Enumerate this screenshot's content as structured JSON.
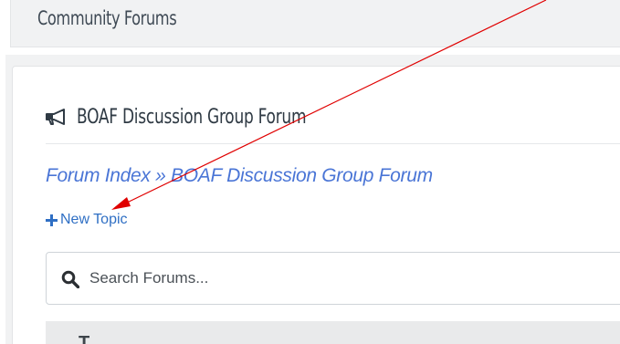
{
  "header": {
    "title": "Community Forums"
  },
  "forum": {
    "title": "BOAF Discussion Group Forum",
    "icon": "megaphone-icon"
  },
  "breadcrumb": {
    "index_label": "Forum Index",
    "separator": " » ",
    "current_label": "BOAF Discussion Group Forum"
  },
  "actions": {
    "new_topic_label": "New Topic",
    "new_topic_icon": "plus-icon"
  },
  "search": {
    "placeholder": "Search Forums...",
    "value": "",
    "icon": "search-icon"
  },
  "table": {
    "header_partial": "T"
  },
  "colors": {
    "link": "#4a75d6",
    "new_topic": "#2f6fc4",
    "annotation_arrow": "#e00000"
  }
}
